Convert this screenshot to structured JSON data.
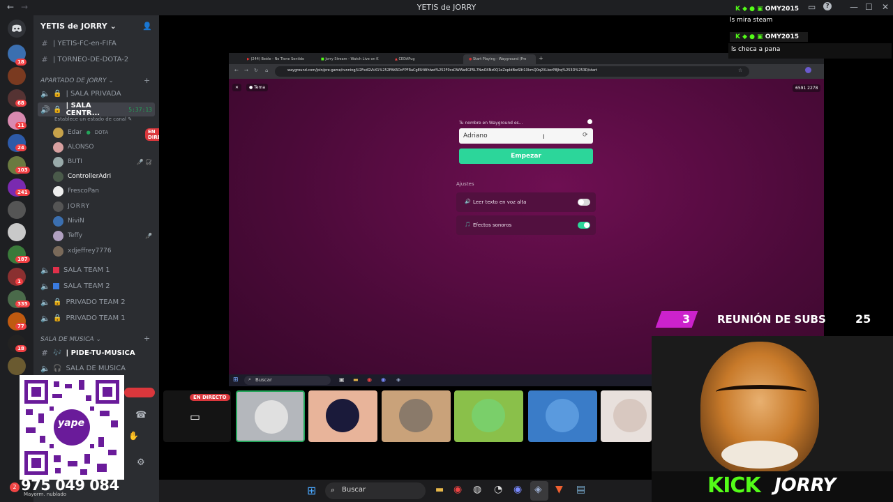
{
  "titlebar": {
    "title": "YETIS de JORRY",
    "help": "?"
  },
  "guild": {
    "name": "YETIS de JORRY"
  },
  "channels": [
    {
      "label": "| YETIS-FC-en-FIFA"
    },
    {
      "label": "| TORNEO-DE-DOTA-2"
    }
  ],
  "categories": {
    "jorry": "APARTADO DE JORRY",
    "music": "SALA DE MUSICA"
  },
  "voice": [
    {
      "label": "| SALA PRIVADA"
    },
    {
      "label": "| SALA CENTR...",
      "time": "5:37:13",
      "status": "Establece un estado de canal"
    },
    {
      "label": "SALA TEAM 1"
    },
    {
      "label": "SALA TEAM 2"
    },
    {
      "label": "PRIVADO TEAM 2"
    },
    {
      "label": "PRIVADO TEAM 1"
    }
  ],
  "users": [
    "Edar",
    "ALONSO",
    "BUTI",
    "ControllerAdri",
    "FrescoPan",
    "JORRY",
    "NiviN",
    "Teffy",
    "xdjeffrey7776"
  ],
  "user_extra": {
    "edar_app": "DOTA"
  },
  "live_badge": "EN DIRECTO",
  "music_channels": [
    "| PIDE-TU-MUSICA",
    "SALA DE MUSICA"
  ],
  "server_badges": [
    "18",
    "68",
    "11",
    "24",
    "103",
    "241",
    "187",
    "1",
    "335",
    "77",
    "18"
  ],
  "browser": {
    "tabs": [
      "(244) Beéle - No Tiene Sentido",
      "Jorry Stream - Watch Live on K",
      "CEDAPug",
      "Start Playing - Wayground (Fre"
    ],
    "url": "wayground.com/join/pre-game/running/U2FsdGVkX1%252FAK6OcFPFRaCgEUtWhIwd%252F0csDWWa4GP5L7NwOXNz0Q1eZxpIdBwS9t1XkmQ0q2XLkorP8Jhq%253D%253D/start"
  },
  "wayground": {
    "theme_btn": "Tema",
    "code": "6591 2278",
    "name_label": "Tu nombre en Wayground es...",
    "name_value": "Adriano",
    "start": "Empezar",
    "settings_title": "Ajustes",
    "setting1": "Leer texto en voz alta",
    "setting2": "Efectos sonoros"
  },
  "inner_taskbar": {
    "search": "Buscar"
  },
  "stream": {
    "live": "EN DIRECTO"
  },
  "chat": [
    {
      "user": "OMY2015",
      "msg": "ls mira steam"
    },
    {
      "user": "OMY2015",
      "msg": "ls checa a pana"
    }
  ],
  "subs": {
    "left": "3",
    "title": "REUNIÓN DE SUBS",
    "right": "25"
  },
  "kick": {
    "brand": "KICK",
    "name": "JORRY"
  },
  "qr": {
    "brand": "yape",
    "phone": "975 049 084"
  },
  "weather": {
    "temp": "2",
    "desc": "Mayorm. nublado"
  },
  "taskbar": {
    "search": "Buscar"
  },
  "colors": {
    "accent": "#2cd69a",
    "page_bg": "#4a0a38",
    "kick_green": "#53fc18",
    "live_red": "#da373c"
  }
}
